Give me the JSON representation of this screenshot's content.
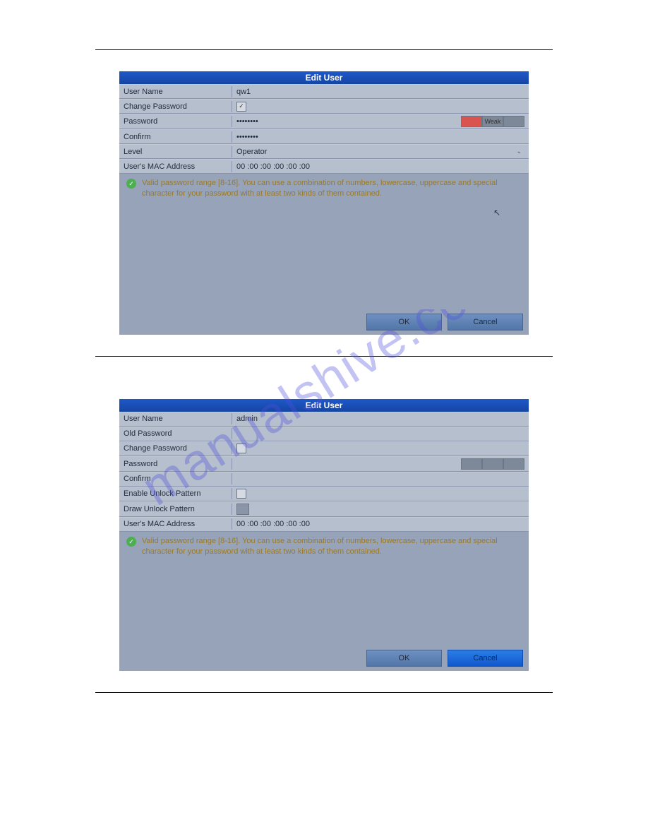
{
  "watermark": "manualshive.com",
  "dialog1": {
    "title": "Edit User",
    "labels": {
      "user_name": "User Name",
      "change_password": "Change Password",
      "password": "Password",
      "confirm": "Confirm",
      "level": "Level",
      "mac": "User's MAC Address"
    },
    "values": {
      "user_name": "qw1",
      "change_password_checked": true,
      "password": "••••••••",
      "confirm": "••••••••",
      "level": "Operator",
      "mac": "00 :00 :00 :00 :00 :00",
      "strength_label": "Weak"
    },
    "hint": "Valid password range [8-16]. You can use a combination of numbers, lowercase, uppercase and special character for your password with at least two kinds of them contained.",
    "buttons": {
      "ok": "OK",
      "cancel": "Cancel"
    }
  },
  "dialog2": {
    "title": "Edit User",
    "labels": {
      "user_name": "User Name",
      "old_password": "Old Password",
      "change_password": "Change Password",
      "password": "Password",
      "confirm": "Confirm",
      "enable_unlock": "Enable Unlock Pattern",
      "draw_unlock": "Draw Unlock Pattern",
      "mac": "User's MAC Address"
    },
    "values": {
      "user_name": "admin",
      "old_password": "",
      "change_password_checked": false,
      "password": "",
      "confirm": "",
      "enable_unlock_checked": false,
      "mac": "00 :00 :00 :00 :00 :00"
    },
    "hint": "Valid password range [8-16]. You can use a combination of numbers, lowercase, uppercase and special character for your password with at least two kinds of them contained.",
    "buttons": {
      "ok": "OK",
      "cancel": "Cancel"
    }
  }
}
